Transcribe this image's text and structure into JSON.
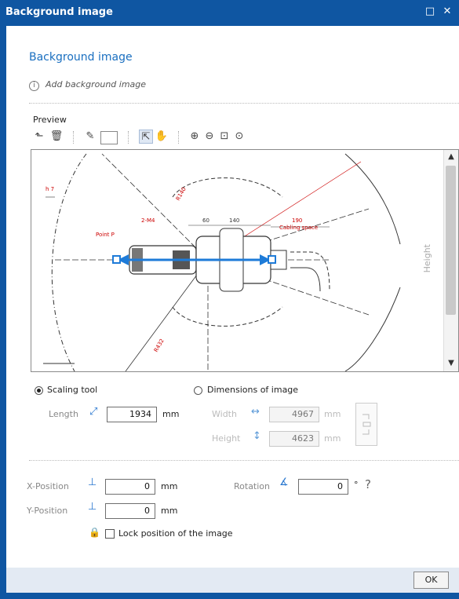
{
  "window": {
    "title": "Background image",
    "maximize_glyph": "□",
    "close_glyph": "✕"
  },
  "heading": "Background image",
  "info": {
    "text": "Add background image",
    "icon_glyph": "i"
  },
  "preview": {
    "label": "Preview",
    "toolbar": {
      "load_glyph": "⬑",
      "delete_glyph": "🗑",
      "picker_glyph": "✎",
      "select_glyph": "⇱",
      "pan_glyph": "✋",
      "zoom_in_glyph": "⊕",
      "zoom_out_glyph": "⊖",
      "fit_glyph": "⊡",
      "zoom_sel_glyph": "⊙"
    },
    "drawing": {
      "labels": [
        "h 7",
        "Point P",
        "2-M4",
        "R140",
        "60",
        "140",
        "190",
        "Cabling space",
        "R432"
      ],
      "colors": {
        "annotation": "#cc0000",
        "scale_line": "#1e7bd8",
        "lines": "#333333"
      }
    },
    "side_label": "Height",
    "scroll_up": "▲",
    "scroll_down": "▼"
  },
  "scaling": {
    "scaling_tool_label": "Scaling tool",
    "scaling_tool_selected": true,
    "length_label": "Length",
    "length_value": "1934",
    "length_unit": "mm",
    "dimensions_label": "Dimensions of image",
    "dimensions_selected": false,
    "width_label": "Width",
    "width_value": "4967",
    "width_unit": "mm",
    "height_label": "Height",
    "height_value": "4623",
    "height_unit": "mm"
  },
  "position": {
    "x_label": "X-Position",
    "x_value": "0",
    "x_unit": "mm",
    "y_label": "Y-Position",
    "y_value": "0",
    "y_unit": "mm",
    "rotation_label": "Rotation",
    "rotation_value": "0",
    "rotation_unit": "°",
    "help_glyph": "?",
    "lock_label": "Lock position of the image",
    "lock_checked": false,
    "lock_glyph": "🔒"
  },
  "footer": {
    "ok_label": "OK"
  }
}
